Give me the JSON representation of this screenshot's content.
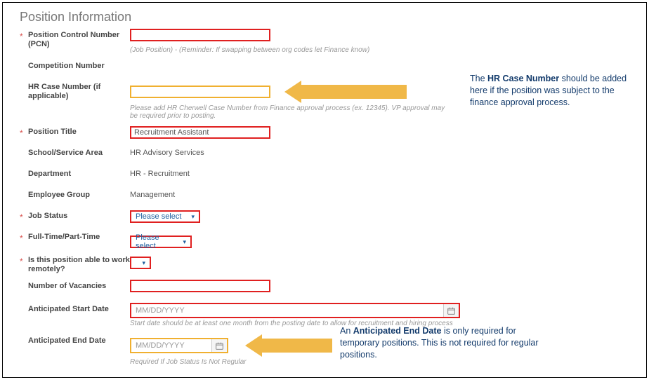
{
  "section_title": "Position Information",
  "fields": {
    "pcn": {
      "label": "Position Control Number (PCN)",
      "hint": "(Job Position) - (Reminder: If swapping between org codes let Finance know)"
    },
    "competition_number": {
      "label": "Competition Number"
    },
    "hr_case": {
      "label": "HR Case Number (if applicable)",
      "hint": "Please add HR Cherwell Case Number from Finance approval process (ex. 12345). VP approval may be required prior to posting."
    },
    "position_title": {
      "label": "Position Title",
      "value": "Recruitment Assistant"
    },
    "school_service": {
      "label": "School/Service Area",
      "value": "HR Advisory Services"
    },
    "department": {
      "label": "Department",
      "value": "HR - Recruitment"
    },
    "employee_group": {
      "label": "Employee Group",
      "value": "Management"
    },
    "job_status": {
      "label": "Job Status",
      "value": "Please select"
    },
    "ft_pt": {
      "label": "Full-Time/Part-Time",
      "value": "Please select"
    },
    "remote": {
      "label": "Is this position able to work remotely?",
      "value": ""
    },
    "vacancies": {
      "label": "Number of Vacancies"
    },
    "start_date": {
      "label": "Anticipated Start Date",
      "value": "MM/DD/YYYY",
      "hint": "Start date should be at least one month from the posting date to allow for recruitment and hiring process"
    },
    "end_date": {
      "label": "Anticipated End Date",
      "value": "MM/DD/YYYY",
      "hint": "Required If Job Status Is Not Regular"
    }
  },
  "annotations": {
    "hr_case_note_pre": "The ",
    "hr_case_note_bold": "HR Case Number",
    "hr_case_note_post": " should be added here if the position was subject to the finance approval process.",
    "end_date_note_pre": "An ",
    "end_date_note_bold": "Anticipated End Date",
    "end_date_note_post": " is only required for temporary positions. This is not required for regular positions."
  }
}
